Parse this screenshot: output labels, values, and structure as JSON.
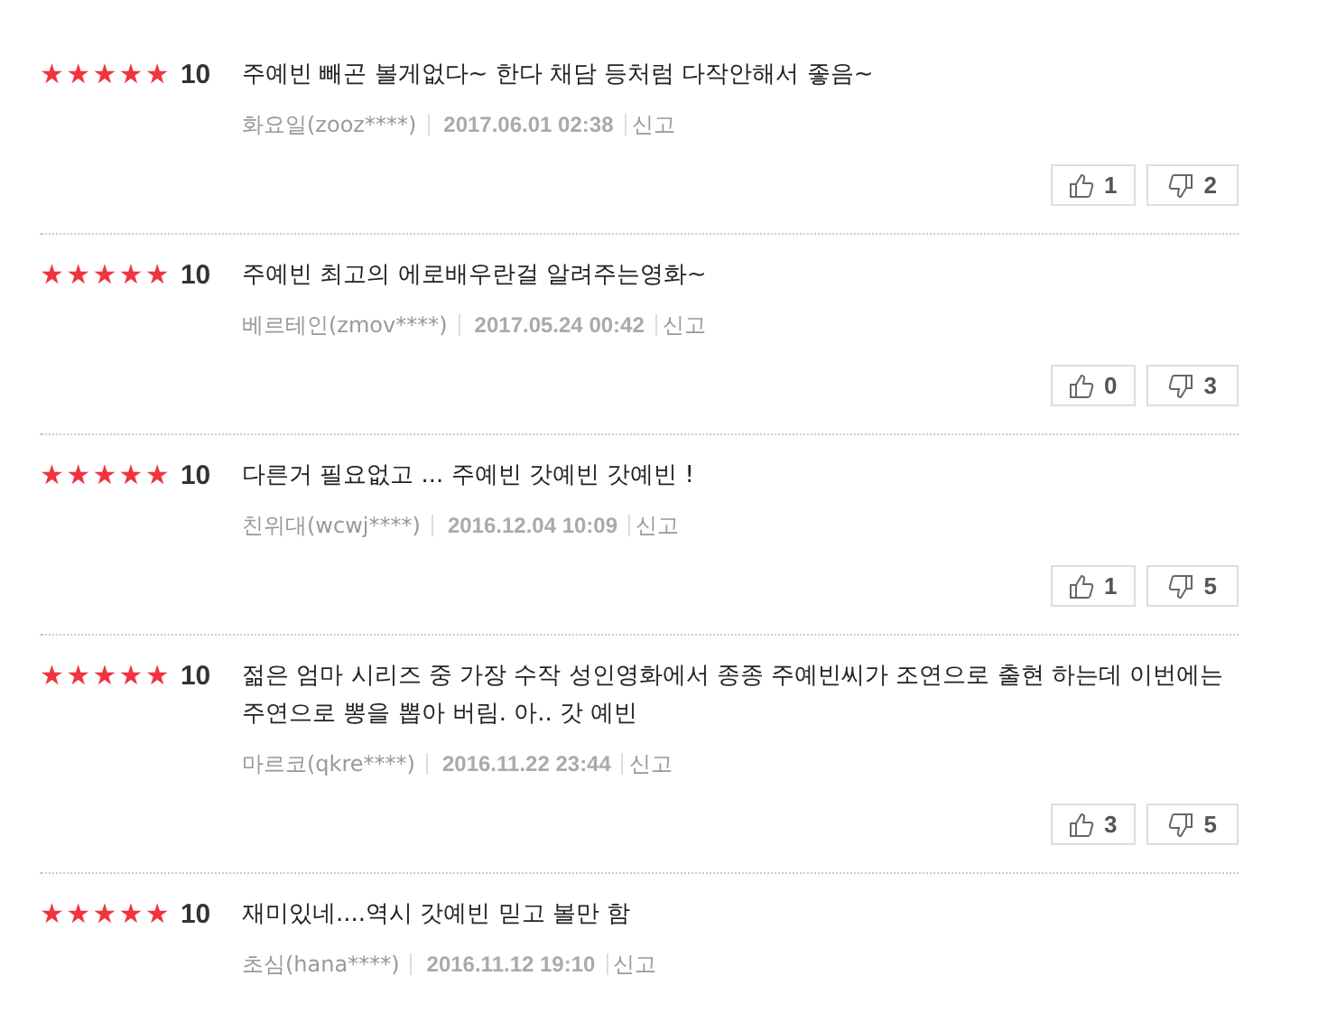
{
  "reviews": [
    {
      "stars": 5,
      "score": "10",
      "text": "주예빈 빼곤 볼게없다~ 한다 채담 등처럼 다작안해서 좋음~",
      "author": "화요일(zooz****)",
      "date": "2017.06.01 02:38",
      "report": "신고",
      "likes": "1",
      "dislikes": "2"
    },
    {
      "stars": 5,
      "score": "10",
      "text": "주예빈 최고의 에로배우란걸 알려주는영화~",
      "author": "베르테인(zmov****)",
      "date": "2017.05.24 00:42",
      "report": "신고",
      "likes": "0",
      "dislikes": "3"
    },
    {
      "stars": 5,
      "score": "10",
      "text": "다른거 필요없고 ... 주예빈 갓예빈 갓예빈 !",
      "author": "친위대(wcwj****)",
      "date": "2016.12.04 10:09",
      "report": "신고",
      "likes": "1",
      "dislikes": "5"
    },
    {
      "stars": 5,
      "score": "10",
      "text": "젊은 엄마 시리즈 중 가장 수작 성인영화에서 종종 주예빈씨가 조연으로 출현 하는데 이번에는 주연으로 뽕을 뽑아 버림. 아.. 갓 예빈",
      "author": "마르코(qkre****)",
      "date": "2016.11.22 23:44",
      "report": "신고",
      "likes": "3",
      "dislikes": "5"
    },
    {
      "stars": 5,
      "score": "10",
      "text": "재미있네....역시 갓예빈 믿고 볼만 함",
      "author": "초심(hana****)",
      "date": "2016.11.12 19:10",
      "report": "신고"
    }
  ]
}
